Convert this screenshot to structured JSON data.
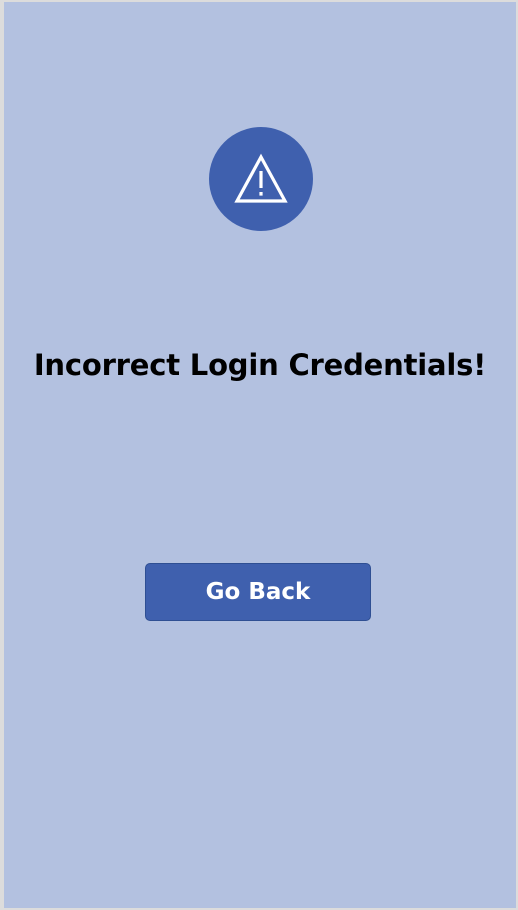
{
  "error_screen": {
    "icon": "warning-icon",
    "message": "Incorrect Login Credentials!",
    "go_back_label": "Go Back"
  },
  "colors": {
    "background": "#b3c1e0",
    "accent": "#3f60ae",
    "text": "#000000",
    "button_text": "#ffffff"
  }
}
